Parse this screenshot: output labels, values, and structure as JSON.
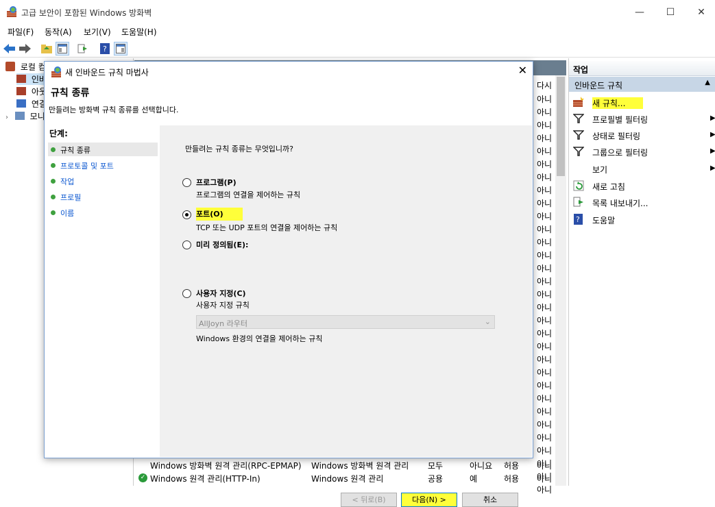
{
  "window": {
    "title": "고급 보안이 포함된 Windows 방화벽",
    "minimize": "—",
    "maximize": "☐",
    "close": "✕"
  },
  "menu": [
    "파일(F)",
    "동작(A)",
    "보기(V)",
    "도움말(H)"
  ],
  "tree": {
    "items": [
      "로컬 컴",
      "인바",
      "아웃",
      "연결",
      "모니"
    ]
  },
  "list": {
    "header_partial": "다시",
    "truncated_cells": [
      "아니",
      "아니",
      "아니",
      "아니",
      "아니",
      "아니",
      "아니",
      "아니",
      "아니",
      "아니",
      "아니",
      "아니",
      "아니",
      "아니",
      "아니",
      "아니",
      "아니",
      "아니",
      "아니",
      "아니",
      "아니",
      "아니",
      "아니",
      "아니",
      "아니",
      "아니",
      "아니",
      "아니",
      "아니",
      "아니",
      "아니"
    ],
    "rows": [
      {
        "name": "Windows 방화벽 원격 관리(RPC-EPMAP)",
        "group": "Windows 방화벽 원격 관리",
        "profile": "모두",
        "enabled": "아니요",
        "action": "허용",
        "override": "아니"
      },
      {
        "name": "Windows 원격 관리(HTTP-In)",
        "group": "Windows 원격 관리",
        "profile": "공용",
        "enabled": "예",
        "action": "허용",
        "override": "아니"
      }
    ]
  },
  "actions": {
    "header": "작업",
    "section": "인바운드 규칙",
    "items": [
      {
        "label": "새 규칙...",
        "icon": "new-rule-icon",
        "submenu": false
      },
      {
        "label": "프로필별 필터링",
        "icon": "filter-icon",
        "submenu": true
      },
      {
        "label": "상태로 필터링",
        "icon": "filter-icon",
        "submenu": true
      },
      {
        "label": "그룹으로 필터링",
        "icon": "filter-icon",
        "submenu": true
      },
      {
        "label": "보기",
        "icon": "",
        "submenu": true
      },
      {
        "label": "새로 고침",
        "icon": "refresh-icon",
        "submenu": false
      },
      {
        "label": "목록 내보내기...",
        "icon": "export-icon",
        "submenu": false
      },
      {
        "label": "도움말",
        "icon": "help-icon",
        "submenu": false
      }
    ]
  },
  "dialog": {
    "title": "새 인바운드 규칙 마법사",
    "heading": "규칙 종류",
    "subheading": "만들려는 방화벽 규칙 종류를 선택합니다.",
    "steps_title": "단계:",
    "steps": [
      "규칙 종류",
      "프로토콜 및 포트",
      "작업",
      "프로필",
      "이름"
    ],
    "question": "만들려는 규칙 종류는 무엇입니까?",
    "options": [
      {
        "label": "프로그램(P)",
        "desc": "프로그램의 연결을 제어하는 규칙"
      },
      {
        "label": "포트(O)",
        "desc": "TCP 또는 UDP 포트의 연결을 제어하는 규칙"
      },
      {
        "label": "미리 정의됨(E):",
        "desc": "Windows 환경의 연결을 제어하는 규칙"
      },
      {
        "label": "사용자 지정(C)",
        "desc": "사용자 지정 규칙"
      }
    ],
    "selected_option": 1,
    "predefined_value": "AllJoyn 라우터",
    "buttons": {
      "back": "< 뒤로(B)",
      "next": "다음(N) >",
      "cancel": "취소"
    }
  },
  "colors": {
    "highlight": "#ffff3a",
    "list_header": "#6a7e8f",
    "actions_section": "#c7d6e6",
    "step_link": "#0b57d0",
    "step_dot": "#3fa13f"
  }
}
